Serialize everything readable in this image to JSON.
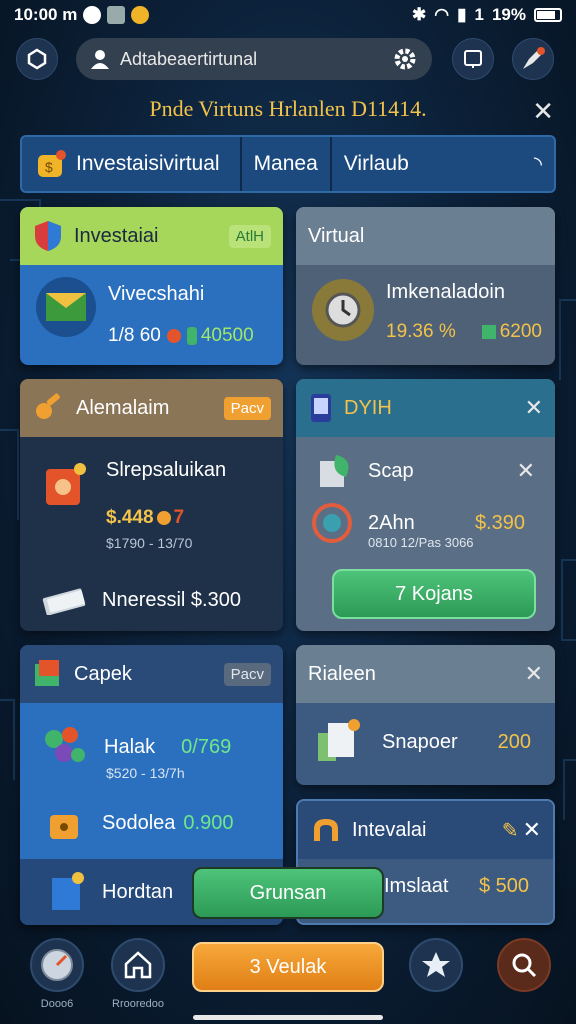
{
  "status_bar": {
    "time": "10:00 m",
    "battery": "19%",
    "signal": "1"
  },
  "top_bar": {
    "search_text": "Adtabeaertirtunal"
  },
  "headline": "Pnde Virtuns Hrlanlen D11414.",
  "tabs": [
    {
      "label": "Investaisivirtual"
    },
    {
      "label": "Manea"
    },
    {
      "label": "Virlaub"
    }
  ],
  "cards": {
    "c1": {
      "title": "Investaiai",
      "badge": "AtlH",
      "item": "Vivecshahi",
      "stats": "1/8 60",
      "value": "40500"
    },
    "c2": {
      "title": "Virtual",
      "item": "Imkenaladoin",
      "stats": "19.36 %",
      "value": "6200"
    },
    "c3": {
      "title": "Alemalaim",
      "badge": "Pacv",
      "item": "Slrepsaluikan",
      "price": "$.448",
      "price_suffix": "7",
      "sub": "$1790 - 13/70",
      "item2": "Nneressil $.300"
    },
    "c4": {
      "title": "DYIH",
      "item": "Scap",
      "item2": "2Ahn",
      "price2": "$.390",
      "sub": "0810 12/Pas 3066",
      "button": "7 Kojans"
    },
    "c5": {
      "title": "Capek",
      "badge": "Pacv",
      "item": "Halak",
      "item_value": "0/769",
      "sub": "$520 - 13/7h",
      "item2": "Sodolea",
      "item2_value": "0.900",
      "item3": "Hordtan"
    },
    "c6": {
      "title": "Rialeen",
      "item": "Snapoer",
      "value": "200"
    },
    "c7": {
      "title": "Intevalai",
      "item": "Imslaat",
      "value": "$ 500"
    }
  },
  "floating_button": "Grunsan",
  "bottom_nav": {
    "left_label": "Dooo6",
    "home_label": "Rrooredoo",
    "center_button": "3 Veulak"
  },
  "colors": {
    "accent_green": "#3fb46a",
    "accent_orange": "#f39a25",
    "gold": "#f2c24a",
    "card_blue": "#2b6fbf"
  }
}
